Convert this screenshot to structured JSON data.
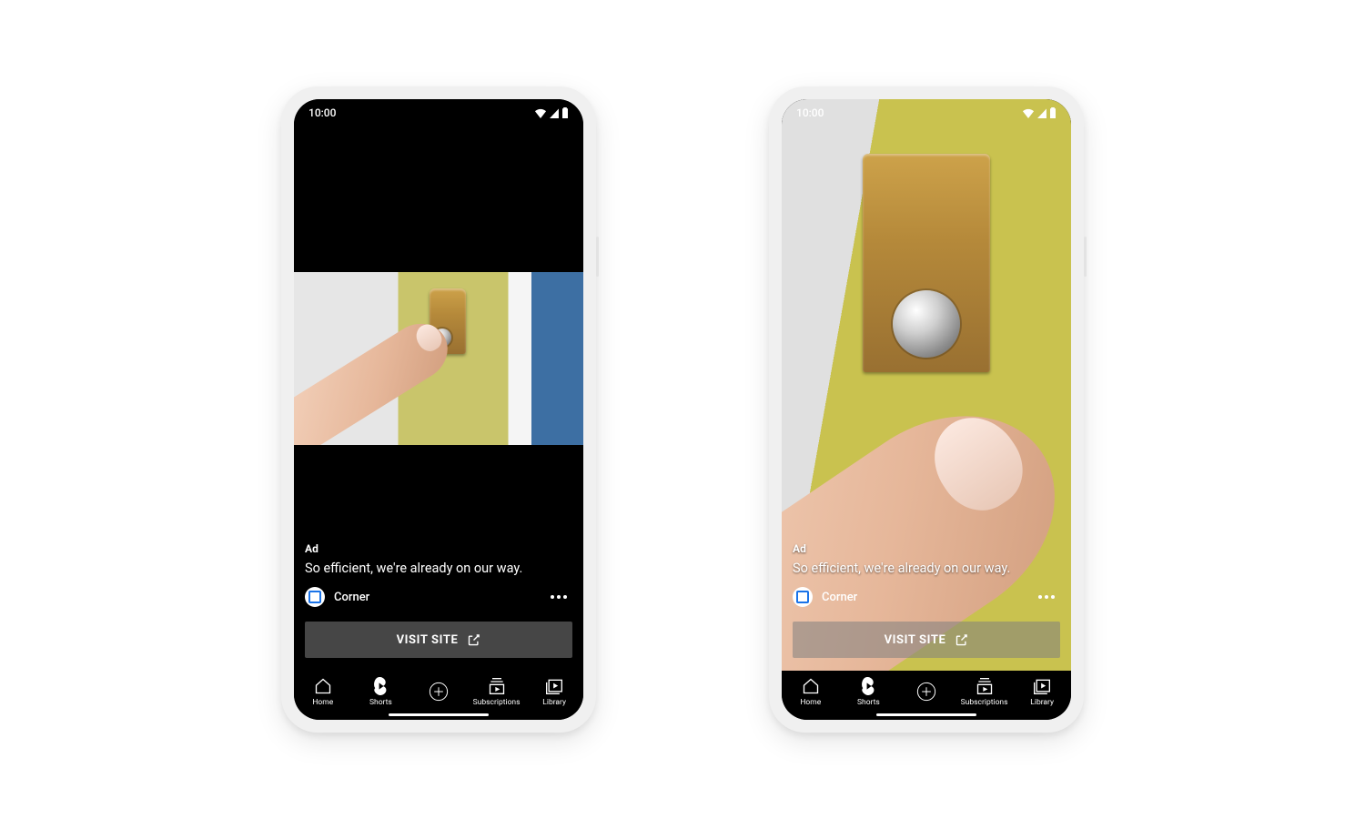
{
  "status_time": "10:00",
  "ad_badge": "Ad",
  "headline": "So efficient, we're already on our way.",
  "brand_name": "Corner",
  "cta_label": "VISIT SITE",
  "nav": {
    "home": "Home",
    "shorts": "Shorts",
    "subscriptions": "Subscriptions",
    "library": "Library"
  }
}
